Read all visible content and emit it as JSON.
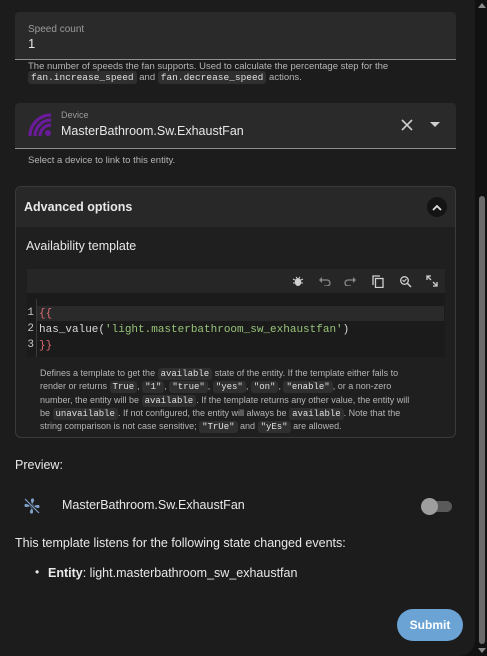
{
  "speed_count": {
    "label": "Speed count",
    "value": "1",
    "helper_prefix": "The number of speeds the fan supports. Used to calculate the percentage step for the",
    "helper_code1": "fan.increase_speed",
    "helper_and": "and",
    "helper_code2": "fan.decrease_speed",
    "helper_suffix": "actions."
  },
  "device": {
    "label": "Device",
    "value": "MasterBathroom.Sw.ExhaustFan",
    "helper": "Select a device to link to this entity.",
    "icon": "wifi-tilted-icon"
  },
  "advanced": {
    "title": "Advanced options",
    "availability_title": "Availability template",
    "toolbar_icons": [
      "bug-icon",
      "undo-icon",
      "redo-icon",
      "copy-icon",
      "search-replace-icon",
      "fullscreen-icon"
    ],
    "code_lines": [
      {
        "num": "1",
        "text": "{{"
      },
      {
        "num": "2",
        "fn": "has_value(",
        "str": "'light.masterbathroom_sw_exhaustfan'",
        "end": ")"
      },
      {
        "num": "3",
        "text": "}}"
      }
    ],
    "help": {
      "p1": "Defines a template to get the",
      "c1": "available",
      "p2": "state of the entity. If the template either fails to",
      "p3": "render or returns",
      "c2": "True",
      "c3": "\"1\"",
      "c4": "\"true\"",
      "c5": "\"yes\"",
      "c6": "\"on\"",
      "c7": "\"enable\"",
      "p4": ", or a non-zero",
      "p5": "number, the entity will be",
      "c8": "available",
      "p6": ". If the template returns any other value, the entity will",
      "p7": "be",
      "c9": "unavailable",
      "p8": ". If not configured, the entity will always be",
      "c10": "available",
      "p9": ". Note that the",
      "p10": "string comparison is not case sensitive;",
      "c11": "\"TrUe\"",
      "p11": "and",
      "c12": "\"yEs\"",
      "p12": "are allowed."
    }
  },
  "preview": {
    "label": "Preview:",
    "entity_name": "MasterBathroom.Sw.ExhaustFan",
    "icon": "fan-off-icon",
    "switch_on": false
  },
  "listens": {
    "text": "This template listens for the following state changed events:",
    "bullet_label": "Entity",
    "bullet_value": ": light.masterbathroom_sw_exhaustfan"
  },
  "submit_label": "Submit",
  "colors": {
    "accent": "#6aa3d4",
    "device_icon": "#6a1b9a",
    "code_brace": "#e06c75",
    "code_string": "#98c379"
  }
}
